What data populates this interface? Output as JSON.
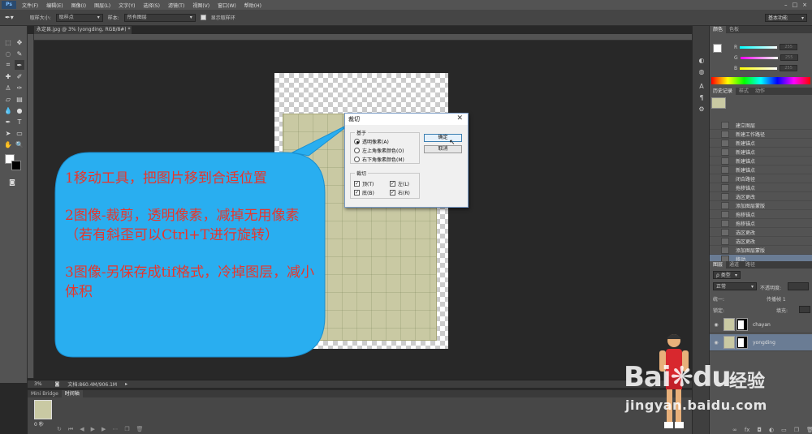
{
  "menu": {
    "app_logo": "Ps",
    "items": [
      "文件(F)",
      "编辑(E)",
      "图像(I)",
      "图层(L)",
      "文字(Y)",
      "选择(S)",
      "滤镜(T)",
      "视图(V)",
      "窗口(W)",
      "帮助(H)"
    ]
  },
  "options": {
    "sample_size_label": "取样大小:",
    "sample_size_value": "取样点",
    "sample_label": "样本:",
    "sample_value": "所有图层",
    "show_ring_label": "显示取样环",
    "workspace": "基本功能"
  },
  "document": {
    "tab_title": "永定县.jpg @ 3% (yongding, RGB/8#) *",
    "zoom": "3%",
    "doc_size": "文档:860.4M/906.1M"
  },
  "bridge": {
    "tabs": [
      "Mini Bridge",
      "时间轴"
    ],
    "frame_time": "0 秒"
  },
  "color_panel": {
    "tabs": [
      "颜色",
      "色板"
    ],
    "channels": [
      {
        "label": "R",
        "value": "255"
      },
      {
        "label": "G",
        "value": "255"
      },
      {
        "label": "B",
        "value": "255"
      }
    ]
  },
  "history_panel": {
    "tabs": [
      "历史记录",
      "样式",
      "动作"
    ],
    "items": [
      "建立图层",
      "新建工作路径",
      "新建锚点",
      "新建锚点",
      "新建锚点",
      "新建锚点",
      "闭合路径",
      "拖移锚点",
      "选区更改",
      "添加图层蒙版",
      "拖移锚点",
      "拖移锚点",
      "选区更改",
      "选区更改",
      "添加图层蒙版",
      "移动"
    ],
    "active_index": 15
  },
  "layers_panel": {
    "tabs": [
      "图层",
      "通道",
      "路径"
    ],
    "filter": "类型",
    "blend_mode": "正常",
    "opacity_label": "不透明度:",
    "lock_label": "锁定:",
    "fill_label": "填充:",
    "propagate_label": "传播帧 1",
    "unify_label": "统一:",
    "layers": [
      {
        "name": "chayan",
        "active": false
      },
      {
        "name": "yongding",
        "active": true
      }
    ]
  },
  "dialog": {
    "title": "裁切",
    "based_on_label": "基于",
    "radios": [
      {
        "label": "透明像素(A)",
        "checked": true
      },
      {
        "label": "左上角像素颜色(O)",
        "checked": false
      },
      {
        "label": "右下角像素颜色(M)",
        "checked": false
      }
    ],
    "trim_label": "裁切",
    "checks": [
      {
        "label": "顶(T)",
        "checked": true
      },
      {
        "label": "左(L)",
        "checked": true
      },
      {
        "label": "底(B)",
        "checked": true
      },
      {
        "label": "右(R)",
        "checked": true
      }
    ],
    "ok_label": "确定",
    "cancel_label": "取消"
  },
  "annotation": {
    "step1": "1移动工具，把图片移到合适位置",
    "step2": "2图像-裁剪，透明像素，减掉无用像素（若有斜歪可以Ctrl+T进行旋转）",
    "step3": "3图像-另保存成tif格式，冷掉图层，减小体积",
    "bubble_color": "#29aef0",
    "text_color": "#e8362b"
  },
  "watermark": {
    "logo": "Bai",
    "logo_suffix": "du",
    "cn": "经验",
    "url": "jingyan.baidu.com"
  },
  "icons": {
    "close": "close-icon",
    "eye": "eye-icon",
    "cursor": "mouse-cursor-icon"
  }
}
